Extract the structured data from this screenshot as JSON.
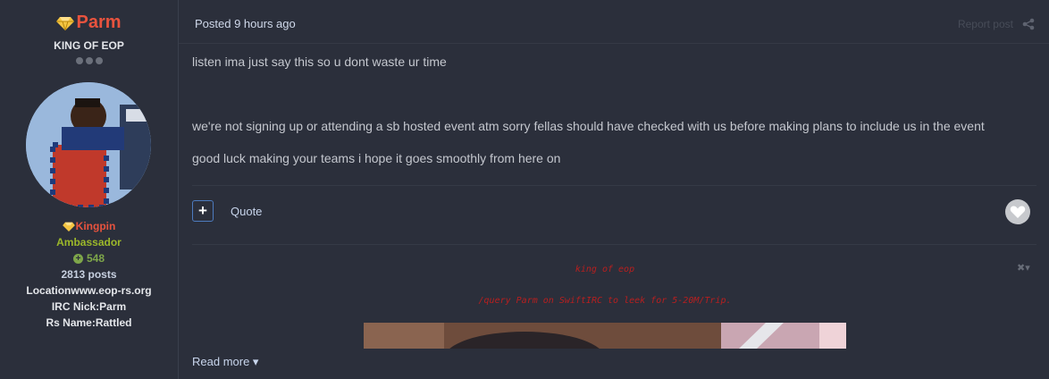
{
  "profile": {
    "username": "Parm",
    "title": "KING OF EOP",
    "rank": "Kingpin",
    "group": "Ambassador",
    "reputation": "548",
    "posts": "2813 posts",
    "location": "Locationwww.eop-rs.org",
    "irc": "IRC Nick:Parm",
    "rs_name": "Rs Name:Rattled"
  },
  "post": {
    "posted": "Posted 9 hours ago",
    "report": "Report post",
    "lines": [
      "listen ima just say this so u dont waste ur time",
      "we're not signing up or attending a sb hosted event atm sorry fellas should have checked with us before making plans to include us in the event",
      "good luck making your teams i hope it goes smoothly from here on"
    ],
    "multiquote": "+",
    "quote": "Quote"
  },
  "signature": {
    "line1": "king of eop",
    "line2": "/query Parm on SwiftIRC to leek for 5-20M/Trip.",
    "controls": "✖▾",
    "read_more": "Read more ▾"
  },
  "colors": {
    "background": "#2b2f3b",
    "username": "#e8533e",
    "group": "#9cb82a",
    "signature": "#b81f1f",
    "link": "#c8d5ec"
  },
  "icons": [
    "gem-icon",
    "rep-plus-icon",
    "share-icon",
    "plus-icon",
    "heart-icon",
    "close-icon"
  ]
}
